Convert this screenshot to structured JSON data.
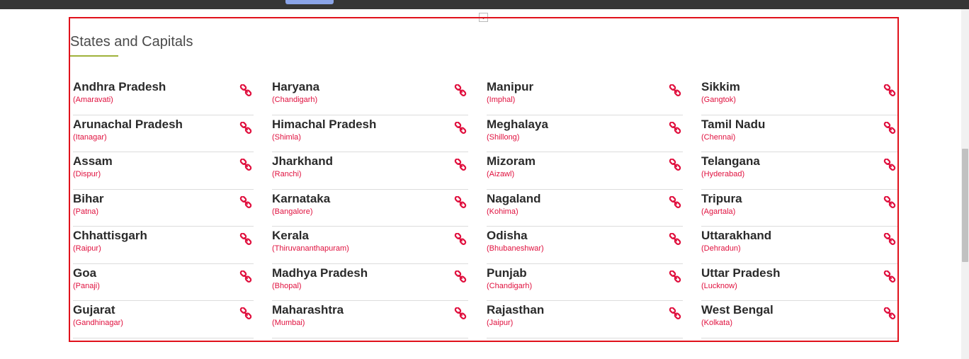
{
  "section": {
    "title": "States and Capitals",
    "toggle_glyph": "⌄"
  },
  "icon": {
    "name": "link-icon",
    "color": "#e0103e"
  },
  "columns": [
    [
      {
        "state": "Andhra Pradesh",
        "capital": "(Amaravati)"
      },
      {
        "state": "Arunachal Pradesh",
        "capital": "(Itanagar)"
      },
      {
        "state": "Assam",
        "capital": "(Dispur)"
      },
      {
        "state": "Bihar",
        "capital": "(Patna)"
      },
      {
        "state": "Chhattisgarh",
        "capital": "(Raipur)"
      },
      {
        "state": "Goa",
        "capital": "(Panaji)"
      },
      {
        "state": "Gujarat",
        "capital": "(Gandhinagar)"
      }
    ],
    [
      {
        "state": "Haryana",
        "capital": "(Chandigarh)"
      },
      {
        "state": "Himachal Pradesh",
        "capital": "(Shimla)"
      },
      {
        "state": "Jharkhand",
        "capital": "(Ranchi)"
      },
      {
        "state": "Karnataka",
        "capital": "(Bangalore)"
      },
      {
        "state": "Kerala",
        "capital": "(Thiruvananthapuram)"
      },
      {
        "state": "Madhya Pradesh",
        "capital": "(Bhopal)"
      },
      {
        "state": "Maharashtra",
        "capital": "(Mumbai)"
      }
    ],
    [
      {
        "state": "Manipur",
        "capital": "(Imphal)"
      },
      {
        "state": "Meghalaya",
        "capital": "(Shillong)"
      },
      {
        "state": "Mizoram",
        "capital": "(Aizawl)"
      },
      {
        "state": "Nagaland",
        "capital": "(Kohima)"
      },
      {
        "state": "Odisha",
        "capital": "(Bhubaneshwar)"
      },
      {
        "state": "Punjab",
        "capital": "(Chandigarh)"
      },
      {
        "state": "Rajasthan",
        "capital": "(Jaipur)"
      }
    ],
    [
      {
        "state": "Sikkim",
        "capital": "(Gangtok)"
      },
      {
        "state": "Tamil Nadu",
        "capital": "(Chennai)"
      },
      {
        "state": "Telangana",
        "capital": "(Hyderabad)"
      },
      {
        "state": "Tripura",
        "capital": "(Agartala)"
      },
      {
        "state": "Uttarakhand",
        "capital": "(Dehradun)"
      },
      {
        "state": "Uttar Pradesh",
        "capital": "(Lucknow)"
      },
      {
        "state": "West Bengal",
        "capital": "(Kolkata)"
      }
    ]
  ]
}
